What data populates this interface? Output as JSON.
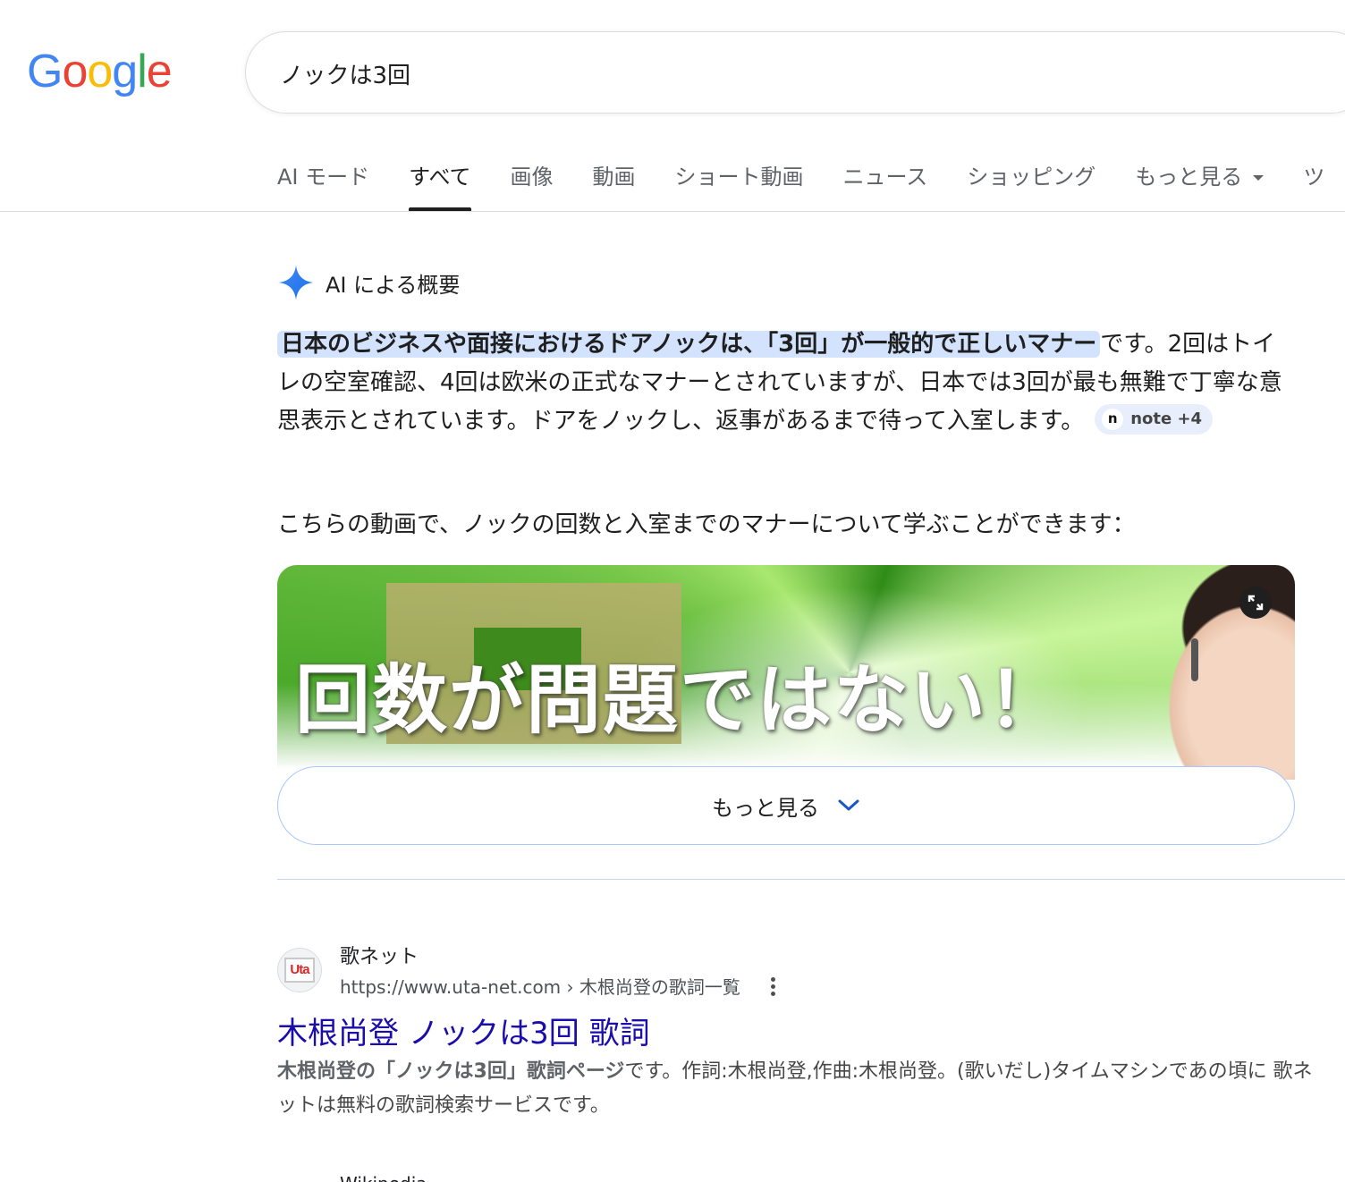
{
  "logo": {
    "letters": [
      "G",
      "o",
      "o",
      "g",
      "l",
      "e"
    ],
    "colors": [
      "#4285F4",
      "#EA4335",
      "#FBBC05",
      "#4285F4",
      "#34A853",
      "#EA4335"
    ]
  },
  "search": {
    "query": "ノックは3回"
  },
  "tabs": [
    {
      "label": "AI モード"
    },
    {
      "label": "すべて"
    },
    {
      "label": "画像"
    },
    {
      "label": "動画"
    },
    {
      "label": "ショート動画"
    },
    {
      "label": "ニュース"
    },
    {
      "label": "ショッピング"
    },
    {
      "label": "もっと見る"
    },
    {
      "label": "ツ"
    }
  ],
  "ai_overview": {
    "title": "AI による概要",
    "highlight": "日本のビジネスや面接におけるドアノックは、「3回」が一般的で正しいマナー",
    "body": "です。2回はトイレの空室確認、4回は欧米の正式なマナーとされていますが、日本では3回が最も無難で丁寧な意思表示とされています。ドアをノックし、返事があるまで待って入室します。",
    "source_chip": "note +4",
    "source_icon": "n",
    "video_intro": "こちらの動画で、ノックの回数と入室までのマナーについて学ぶことができます：",
    "video_caption": "回数が問題ではない！",
    "more_label": "もっと見る",
    "accent": "#d3e3fd"
  },
  "result": {
    "site_name": "歌ネット",
    "favicon_text": "Uta",
    "url": "https://www.uta-net.com › 木根尚登の歌詞一覧",
    "title": "木根尚登 ノックは3回 歌詞",
    "snippet_bold": "木根尚登の「ノックは3回」歌詞ページ",
    "snippet_rest": "です。作詞:木根尚登,作曲:木根尚登。(歌いだし)タイムマシンであの頃に 歌ネットは無料の歌詞検索サービスです。"
  },
  "next_result_partial": "Wikipedia"
}
